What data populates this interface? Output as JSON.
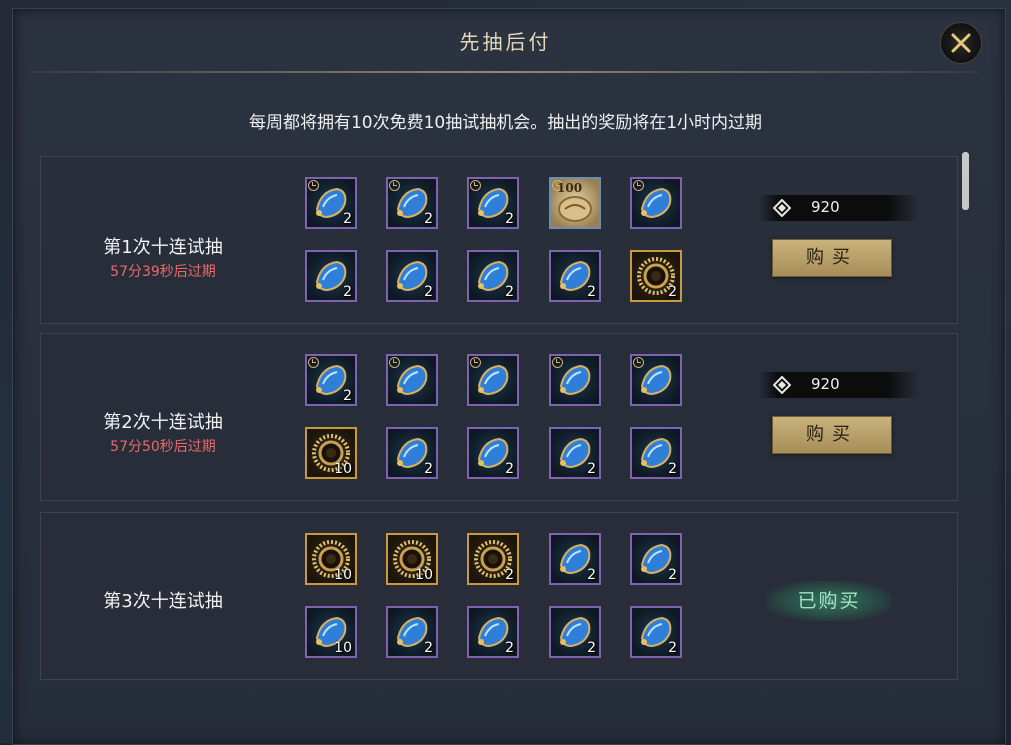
{
  "dialog": {
    "title": "先抽后付",
    "notice": "每周都将拥有10次免费10抽试抽机会。抽出的奖励将在1小时内过期"
  },
  "colors": {
    "expire_text": "#e86a6a",
    "buy_button": "#c9b27c",
    "bought_text": "#9ee6c4",
    "item_border_purple": "#7f62b0",
    "item_border_gold": "#c89a3c"
  },
  "rows": [
    {
      "title": "第1次十连试抽",
      "expire": "57分39秒后过期",
      "price": "920",
      "buy_label": "购买",
      "items": [
        {
          "type": "gem",
          "qty": "2",
          "clock": true
        },
        {
          "type": "gem",
          "qty": "2",
          "clock": true
        },
        {
          "type": "gem",
          "qty": "2",
          "clock": true
        },
        {
          "type": "scroll",
          "qty": "",
          "badge": "100",
          "clock": true
        },
        {
          "type": "gem",
          "qty": "",
          "clock": true
        },
        {
          "type": "gem",
          "qty": "2",
          "clock": false
        },
        {
          "type": "gem",
          "qty": "2",
          "clock": false
        },
        {
          "type": "gem",
          "qty": "2",
          "clock": false
        },
        {
          "type": "gem",
          "qty": "2",
          "clock": false
        },
        {
          "type": "ring",
          "qty": "2",
          "clock": false
        }
      ]
    },
    {
      "title": "第2次十连试抽",
      "expire": "57分50秒后过期",
      "price": "920",
      "buy_label": "购买",
      "items": [
        {
          "type": "gem",
          "qty": "2",
          "clock": true
        },
        {
          "type": "gem",
          "qty": "",
          "clock": true
        },
        {
          "type": "gem",
          "qty": "",
          "clock": true
        },
        {
          "type": "gem",
          "qty": "",
          "clock": true
        },
        {
          "type": "gem",
          "qty": "",
          "clock": true
        },
        {
          "type": "ring",
          "qty": "10",
          "clock": false
        },
        {
          "type": "gem",
          "qty": "2",
          "clock": false
        },
        {
          "type": "gem",
          "qty": "2",
          "clock": false
        },
        {
          "type": "gem",
          "qty": "2",
          "clock": false
        },
        {
          "type": "gem",
          "qty": "2",
          "clock": false
        }
      ]
    },
    {
      "title": "第3次十连试抽",
      "expire": "",
      "status_label": "已购买",
      "items": [
        {
          "type": "ring",
          "qty": "10",
          "clock": false
        },
        {
          "type": "ring",
          "qty": "10",
          "clock": false
        },
        {
          "type": "ring",
          "qty": "2",
          "clock": false
        },
        {
          "type": "gem",
          "qty": "2",
          "clock": false
        },
        {
          "type": "gem",
          "qty": "2",
          "clock": false
        },
        {
          "type": "gem",
          "qty": "10",
          "clock": false
        },
        {
          "type": "gem",
          "qty": "2",
          "clock": false
        },
        {
          "type": "gem",
          "qty": "2",
          "clock": false
        },
        {
          "type": "gem",
          "qty": "2",
          "clock": false
        },
        {
          "type": "gem",
          "qty": "2",
          "clock": false
        }
      ]
    }
  ]
}
